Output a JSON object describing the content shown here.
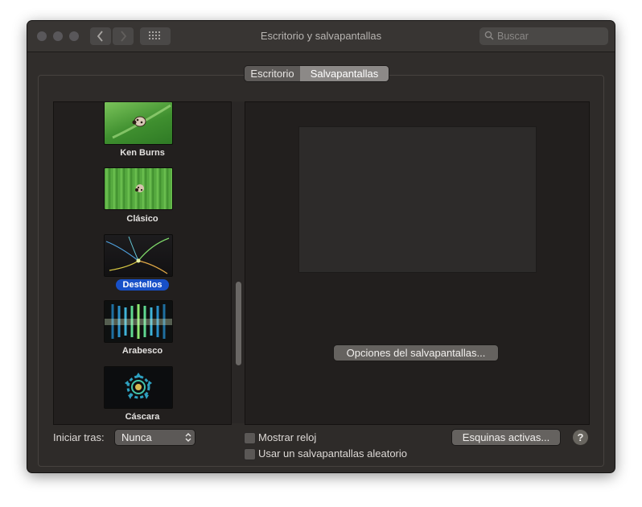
{
  "window": {
    "title": "Escritorio y salvapantallas",
    "search_placeholder": "Buscar"
  },
  "tabs": [
    {
      "label": "Escritorio",
      "selected": false
    },
    {
      "label": "Salvapantallas",
      "selected": true
    }
  ],
  "screensavers": [
    {
      "name": "Ken Burns",
      "icon": "ladybug-photo",
      "selected": false
    },
    {
      "name": "Clásico",
      "icon": "ladybug-grass-photo",
      "selected": false
    },
    {
      "name": "Destellos",
      "icon": "flurry-streaks",
      "selected": true
    },
    {
      "name": "Arabesco",
      "icon": "arabesque-lights",
      "selected": false
    },
    {
      "name": "Cáscara",
      "icon": "shell-flower",
      "selected": false
    }
  ],
  "preview": {
    "options_button": "Opciones del salvapantallas..."
  },
  "footer": {
    "start_after_label": "Iniciar tras:",
    "start_after_value": "Nunca",
    "show_clock_label": "Mostrar reloj",
    "show_clock_checked": false,
    "random_label": "Usar un salvapantallas aleatorio",
    "random_checked": false,
    "hot_corners_button": "Esquinas activas...",
    "help_button": "?"
  },
  "colors": {
    "selection": "#1850c8",
    "window_bg": "#302d2b"
  }
}
